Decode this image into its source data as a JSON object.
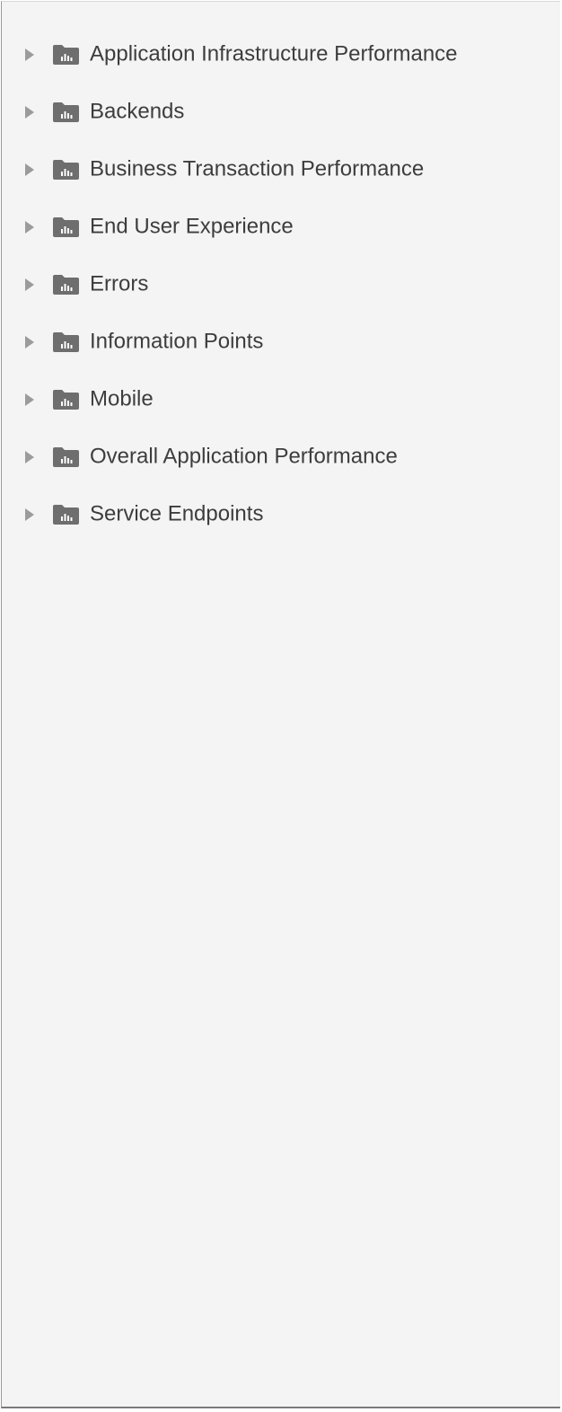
{
  "tree": {
    "items": [
      {
        "label": "Application Infrastructure Performance",
        "icon": "folder-chart-icon",
        "expander": "caret-right-icon"
      },
      {
        "label": "Backends",
        "icon": "folder-chart-icon",
        "expander": "caret-right-icon"
      },
      {
        "label": "Business Transaction Performance",
        "icon": "folder-chart-icon",
        "expander": "caret-right-icon"
      },
      {
        "label": "End User Experience",
        "icon": "folder-chart-icon",
        "expander": "caret-right-icon"
      },
      {
        "label": "Errors",
        "icon": "folder-chart-icon",
        "expander": "caret-right-icon"
      },
      {
        "label": "Information Points",
        "icon": "folder-chart-icon",
        "expander": "caret-right-icon"
      },
      {
        "label": "Mobile",
        "icon": "folder-chart-icon",
        "expander": "caret-right-icon"
      },
      {
        "label": "Overall Application Performance",
        "icon": "folder-chart-icon",
        "expander": "caret-right-icon"
      },
      {
        "label": "Service Endpoints",
        "icon": "folder-chart-icon",
        "expander": "caret-right-icon"
      }
    ]
  },
  "colors": {
    "panel_background": "#f4f4f4",
    "text": "#3d3d3d",
    "folder_icon": "#6e6e6e",
    "caret_icon": "#9b9b9b"
  }
}
